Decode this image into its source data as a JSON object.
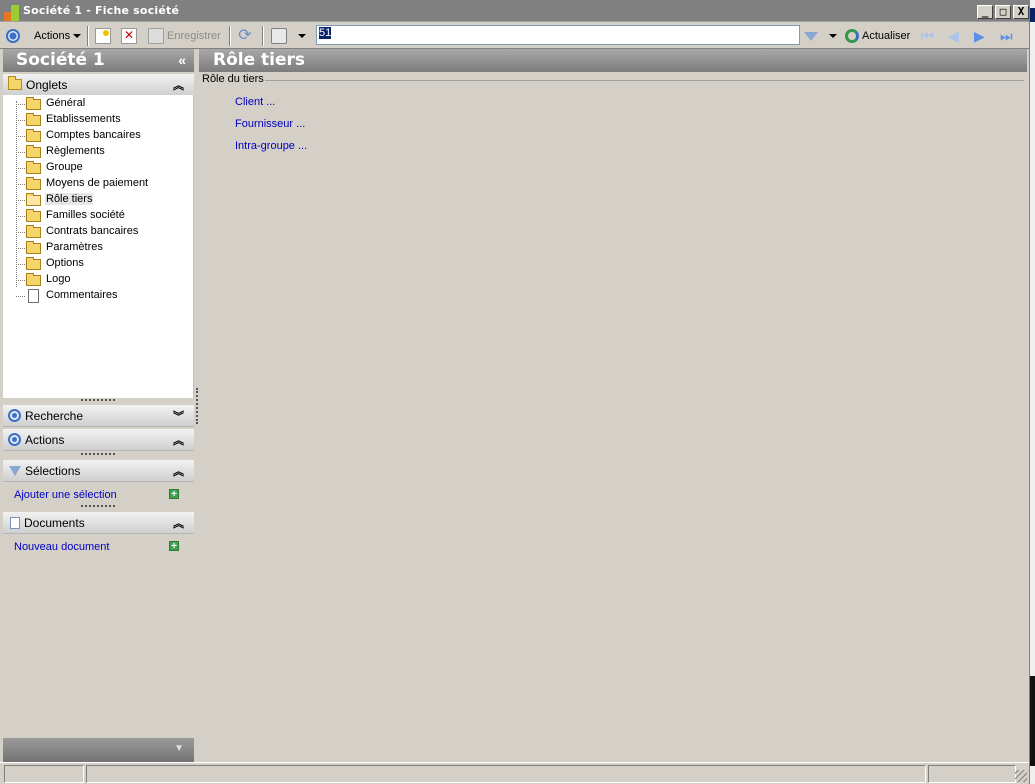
{
  "window": {
    "title": "Société 1 - Fiche société",
    "buttons": [
      "_",
      "□",
      "X"
    ]
  },
  "toolbar": {
    "actions_label": "Actions",
    "save_label": "Enregistrer",
    "search_value": "51",
    "refresh_label": "Actualiser"
  },
  "left_panel": {
    "title": "Société 1",
    "collapse_glyph": "«",
    "onglets_label": "Onglets",
    "tree_items": [
      {
        "label": "Général",
        "icon": "folder-icon",
        "selected": false
      },
      {
        "label": "Etablissements",
        "icon": "folder-icon",
        "selected": false
      },
      {
        "label": "Comptes bancaires",
        "icon": "folder-icon",
        "selected": false
      },
      {
        "label": "Règlements",
        "icon": "folder-icon",
        "selected": false
      },
      {
        "label": "Groupe",
        "icon": "folder-icon",
        "selected": false
      },
      {
        "label": "Moyens de paiement",
        "icon": "folder-icon",
        "selected": false
      },
      {
        "label": "Rôle tiers",
        "icon": "folder-open-icon",
        "selected": true
      },
      {
        "label": "Familles société",
        "icon": "folder-icon",
        "selected": false
      },
      {
        "label": "Contrats bancaires",
        "icon": "folder-icon",
        "selected": false
      },
      {
        "label": "Paramètres",
        "icon": "folder-icon",
        "selected": false
      },
      {
        "label": "Options",
        "icon": "folder-icon",
        "selected": false
      },
      {
        "label": "Logo",
        "icon": "folder-icon",
        "selected": false
      },
      {
        "label": "Commentaires",
        "icon": "note-icon",
        "selected": false
      }
    ],
    "recherche_label": "Recherche",
    "actions_label": "Actions",
    "selections_label": "Sélections",
    "add_selection_link": "Ajouter une sélection",
    "documents_label": "Documents",
    "new_document_link": "Nouveau document"
  },
  "main": {
    "title": "Rôle tiers",
    "group_label": "Rôle du tiers",
    "links": [
      "Client ...",
      "Fournisseur ...",
      "Intra-groupe ..."
    ]
  },
  "colors": {
    "header_gray": "#8c8c8c",
    "link_blue": "#0000c0",
    "window_bg": "#d4d0c8",
    "accent_blue": "#3a6fc4"
  }
}
